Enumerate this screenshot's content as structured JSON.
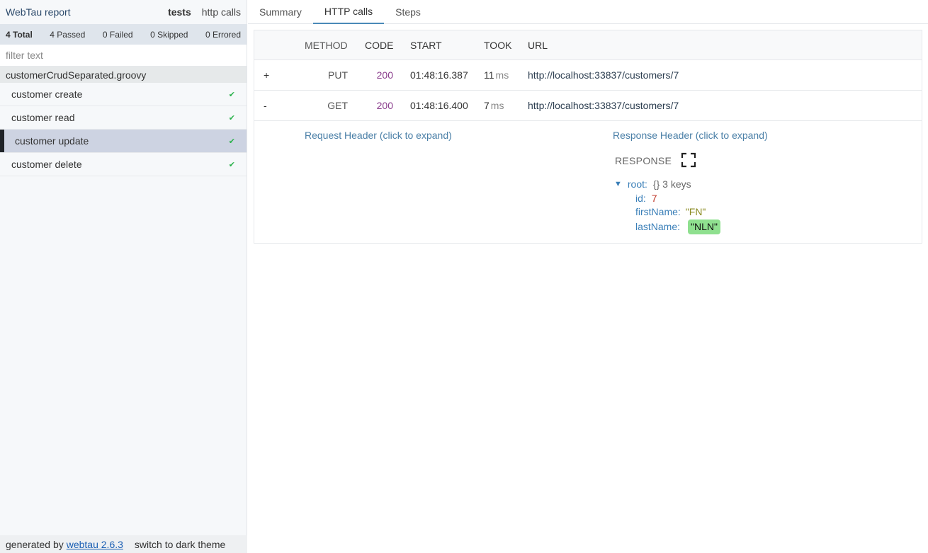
{
  "sidebar": {
    "title": "WebTau report",
    "modes": [
      "tests",
      "http calls"
    ],
    "stats": {
      "total": "4 Total",
      "passed": "4 Passed",
      "failed": "0 Failed",
      "skipped": "0 Skipped",
      "errored": "0 Errored"
    },
    "filter_placeholder": "filter text",
    "file": "customerCrudSeparated.groovy",
    "tests": [
      {
        "label": "customer create",
        "status": "✔"
      },
      {
        "label": "customer read",
        "status": "✔"
      },
      {
        "label": "customer update",
        "status": "✔"
      },
      {
        "label": "customer delete",
        "status": "✔"
      }
    ],
    "footer": {
      "generated_by": "generated by",
      "link": "webtau 2.6.3",
      "theme": "switch to dark theme"
    }
  },
  "tabs": [
    "Summary",
    "HTTP calls",
    "Steps"
  ],
  "table": {
    "headers": {
      "method": "METHOD",
      "code": "CODE",
      "start": "START",
      "took": "TOOK",
      "url": "URL"
    },
    "rows": [
      {
        "toggle": "+",
        "method": "PUT",
        "code": "200",
        "start": "01:48:16.387",
        "took": "11",
        "unit": "ms",
        "url": "http://localhost:33837/customers/7"
      },
      {
        "toggle": "-",
        "method": "GET",
        "code": "200",
        "start": "01:48:16.400",
        "took": "7",
        "unit": "ms",
        "url": "http://localhost:33837/customers/7"
      }
    ]
  },
  "details": {
    "request_header": "Request Header (click to expand)",
    "response_header": "Response Header (click to expand)",
    "response_label": "RESPONSE",
    "json": {
      "root_key": "root:",
      "root_meta": "{}  3 keys",
      "id_key": "id:",
      "id_val": "7",
      "first_key": "firstName:",
      "first_val": "\"FN\"",
      "last_key": "lastName:",
      "last_val": "\"NLN\""
    }
  },
  "colors": {
    "accent": "#4a8ab8",
    "status_code": "#8a3c8c",
    "pass": "#2bb24c",
    "highlight": "#8fe08f"
  }
}
